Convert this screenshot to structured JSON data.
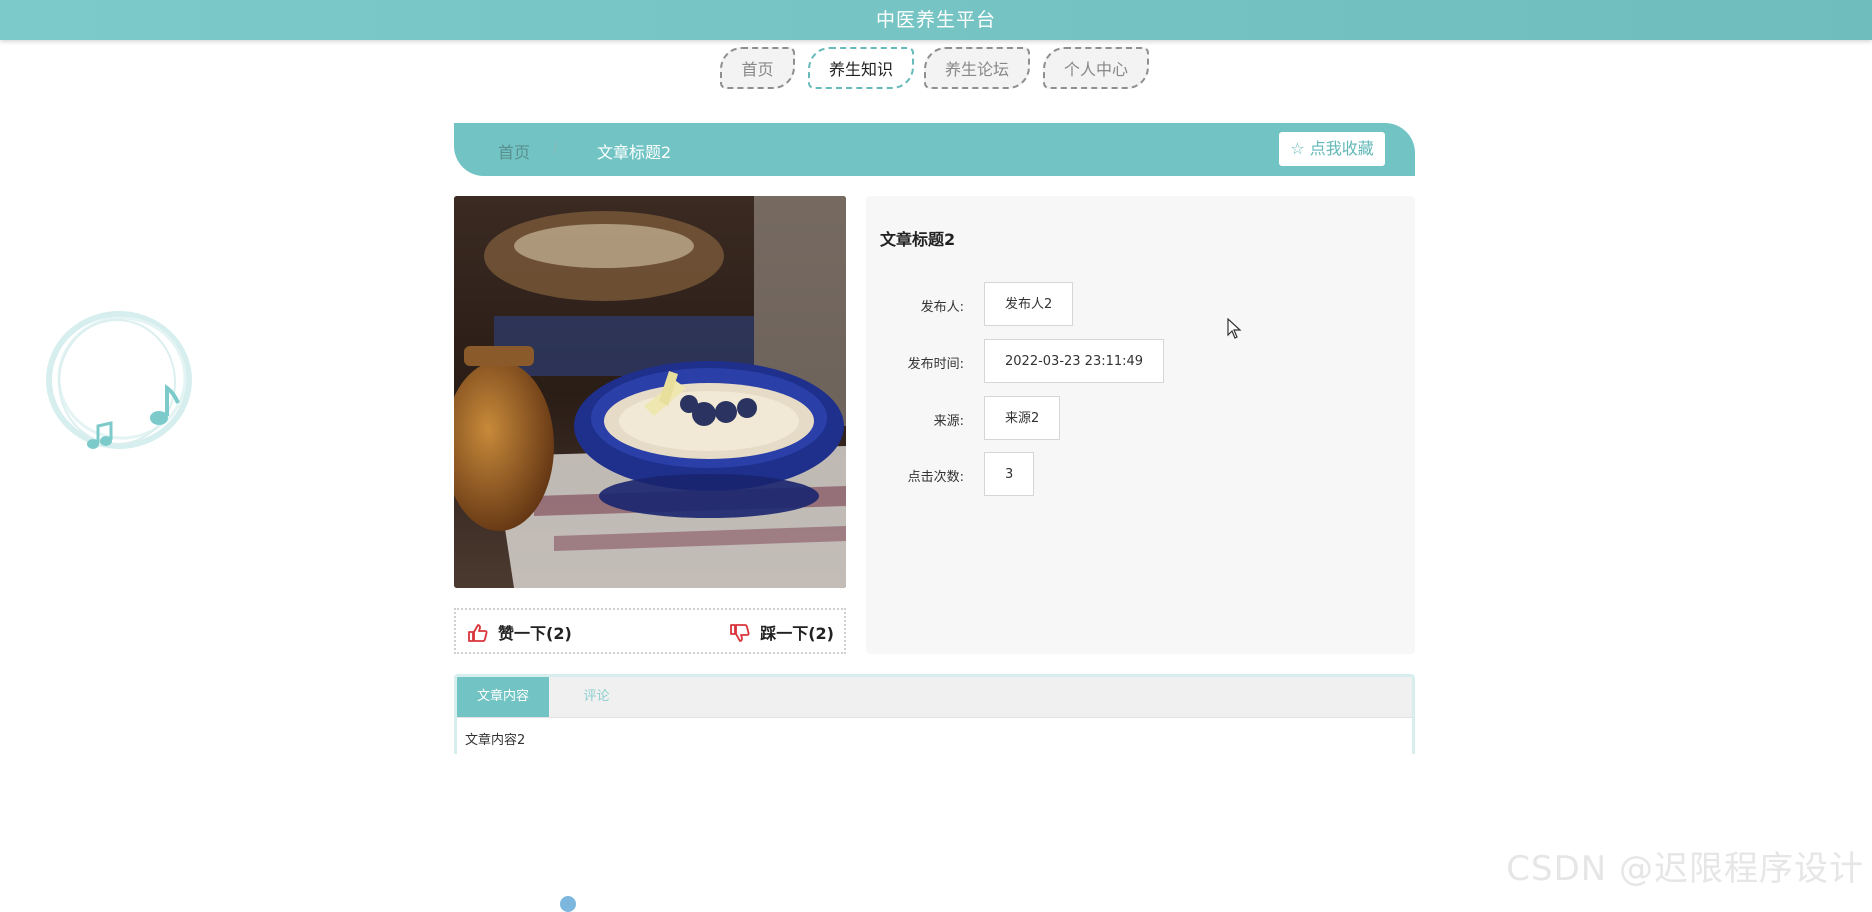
{
  "app": {
    "title": "中医养生平台"
  },
  "nav": {
    "items": [
      {
        "label": "首页"
      },
      {
        "label": "养生知识"
      },
      {
        "label": "养生论坛"
      },
      {
        "label": "个人中心"
      }
    ],
    "active_index": 1
  },
  "breadcrumb": {
    "home": "首页",
    "separator": "/",
    "current": "文章标题2"
  },
  "favorite_button": {
    "label": "☆ 点我收藏"
  },
  "article": {
    "title": "文章标题2",
    "fields": [
      {
        "label": "发布人:",
        "value": "发布人2"
      },
      {
        "label": "发布时间:",
        "value": "2022-03-23 23:11:49"
      },
      {
        "label": "来源:",
        "value": "来源2"
      },
      {
        "label": "点击次数:",
        "value": "3"
      }
    ]
  },
  "votes": {
    "up_label": "赞一下(2)",
    "down_label": "踩一下(2)"
  },
  "tabs": {
    "items": [
      {
        "label": "文章内容"
      },
      {
        "label": "评论"
      }
    ],
    "active_index": 0,
    "content": "文章内容2"
  },
  "watermark": "CSDN @迟限程序设计",
  "colors": {
    "accent": "#72c4c4",
    "like_icon": "#d9343c",
    "text": "#333333"
  }
}
